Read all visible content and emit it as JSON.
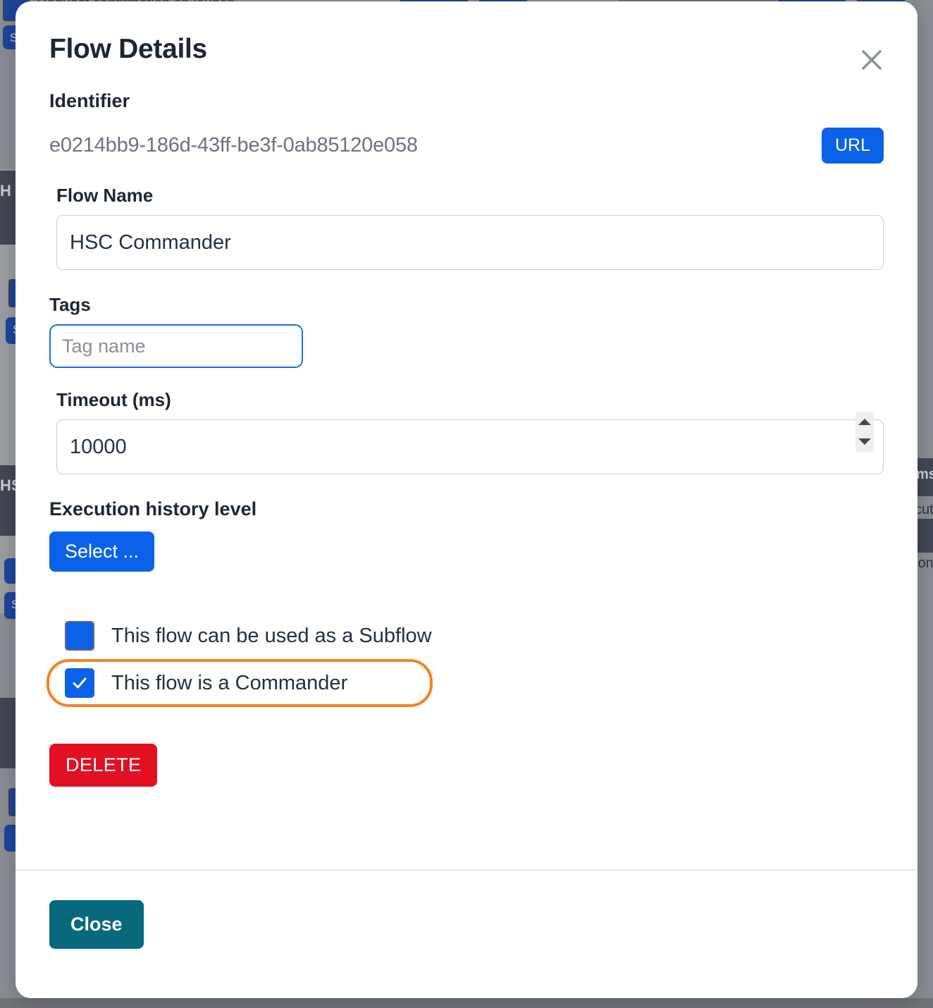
{
  "modal": {
    "title": "Flow Details",
    "close_icon": "close-x-icon",
    "identifier": {
      "label": "Identifier",
      "value": "e0214bb9-186d-43ff-be3f-0ab85120e058",
      "url_button": "URL"
    },
    "flow_name": {
      "label": "Flow Name",
      "value": "HSC Commander"
    },
    "tags": {
      "label": "Tags",
      "value": "",
      "placeholder": "Tag name"
    },
    "timeout": {
      "label": "Timeout (ms)",
      "value": "10000"
    },
    "execution_history": {
      "label": "Execution history level",
      "select_button": "Select ..."
    },
    "checkboxes": [
      {
        "label": "This flow can be used as a Subflow",
        "checked": false,
        "highlighted": false
      },
      {
        "label": "This flow is a Commander",
        "checked": true,
        "highlighted": true
      }
    ],
    "delete_button": "DELETE",
    "footer": {
      "close_button": "Close"
    }
  },
  "colors": {
    "primary_blue": "#0b62e8",
    "delete_red": "#e21022",
    "close_teal": "#08697d",
    "highlight_orange": "#f58220",
    "focus_blue": "#1472e6",
    "backdrop_gray": "#8a8d93"
  },
  "background": {
    "top_text": "Request confirmation on launch",
    "right_fragments": [
      "ms",
      "cute",
      "ion"
    ],
    "card_headers": [
      "H",
      "HS"
    ],
    "button_fragments": [
      "S",
      "S",
      "S"
    ]
  }
}
